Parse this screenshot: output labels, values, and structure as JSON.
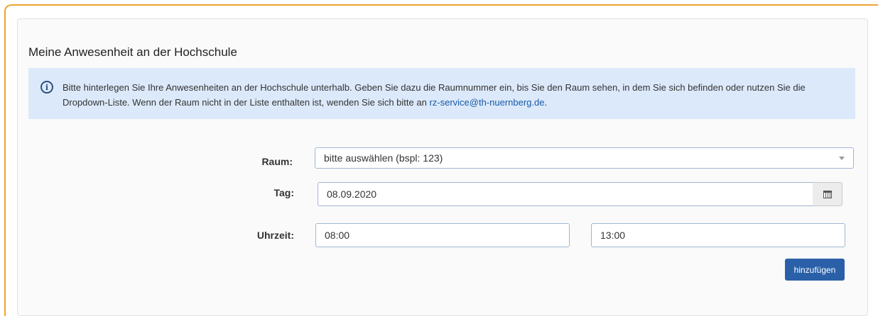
{
  "section": {
    "title": "Meine Anwesenheit an der Hochschule"
  },
  "alert": {
    "text_before_link": "Bitte hinterlegen Sie Ihre Anwesenheiten an der Hochschule unterhalb. Geben Sie dazu die Raumnummer ein, bis Sie den Raum sehen, in dem Sie sich befinden oder nutzen Sie die Dropdown-Liste. Wenn der Raum nicht in der Liste enthalten ist, wenden Sie sich bitte an ",
    "link_text": "rz-service@th-nuernberg.de",
    "text_after_link": ".",
    "icon": "info-icon"
  },
  "form": {
    "room_label": "Raum:",
    "room_value": "bitte auswählen (bspl: 123)",
    "day_label": "Tag:",
    "day_value": "08.09.2020",
    "time_label": "Uhrzeit:",
    "time_from": "08:00",
    "time_to": "13:00",
    "calendar_icon": "calendar-icon",
    "submit_label": "hinzufügen"
  },
  "colors": {
    "accent_border": "#f0a430",
    "alert_bg": "#dbe9fa",
    "primary_button": "#2a60a8",
    "link": "#1a5aa8"
  }
}
